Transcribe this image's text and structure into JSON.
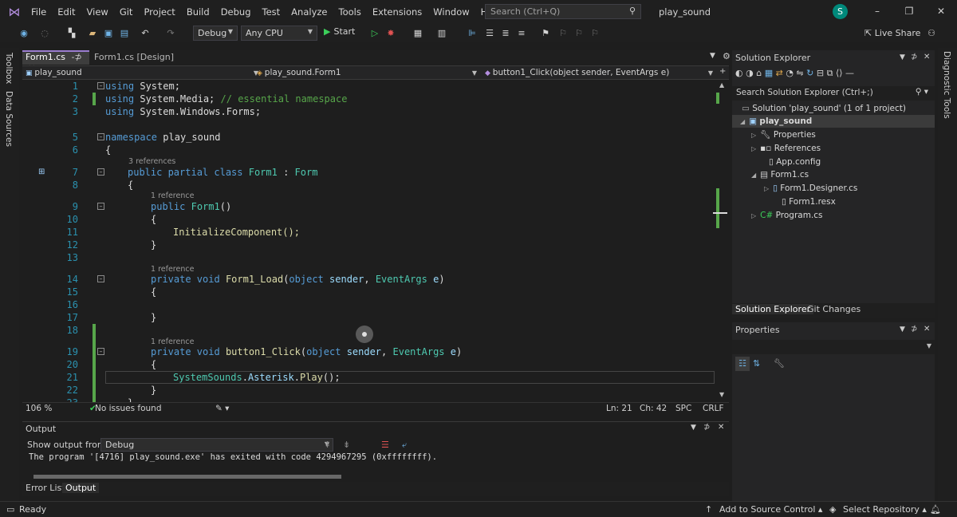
{
  "menu": {
    "items": [
      "File",
      "Edit",
      "View",
      "Git",
      "Project",
      "Build",
      "Debug",
      "Test",
      "Analyze",
      "Tools",
      "Extensions",
      "Window",
      "Help"
    ],
    "search_placeholder": "Search (Ctrl+Q)",
    "app_name": "play_sound",
    "avatar_letter": "S"
  },
  "toolbar": {
    "config": "Debug",
    "platform": "Any CPU",
    "start_label": "Start",
    "live_share": "Live Share"
  },
  "left_rail": {
    "toolbox": "Toolbox",
    "data_sources": "Data Sources"
  },
  "right_rail": {
    "diagnostic_tools": "Diagnostic Tools"
  },
  "tabs": {
    "active": "Form1.cs",
    "active_suffix": "-⊅",
    "designer": "Form1.cs [Design]"
  },
  "navbar": {
    "project": "play_sound",
    "class": "play_sound.Form1",
    "member": "button1_Click(object sender, EventArgs e)"
  },
  "editor": {
    "zoom": "106 %",
    "issues": "No issues found",
    "line": "Ln: 21",
    "col": "Ch: 42",
    "spc": "SPC",
    "eol": "CRLF",
    "refs": {
      "three": "3 references",
      "one": "1 reference"
    },
    "lines": {
      "l1": "using System;",
      "l2a": "using System.Media;",
      "l2b": "// essential namespace",
      "l3": "using System.Windows.Forms;",
      "l5a": "namespace",
      "l5b": "play_sound",
      "l6": "{",
      "l7a": "public partial class",
      "l7b": "Form1",
      "l7c": "Form",
      "l8": "{",
      "l9a": "public",
      "l9b": "Form1",
      "l10": "{",
      "l11": "InitializeComponent();",
      "l12": "}",
      "l14a": "private void",
      "l14b": "Form1_Load",
      "l14c": "object",
      "l14d": "sender",
      "l14e": "EventArgs",
      "l14f": "e",
      "l15": "{",
      "l17": "}",
      "l19a": "private void",
      "l19b": "button1_Click",
      "l19c": "object",
      "l19d": "sender",
      "l19e": "EventArgs",
      "l19f": "e",
      "l20": "{",
      "l21a": "SystemSounds",
      "l21b": "Asterisk",
      "l21c": "Play",
      "l22": "}",
      "l23": "}"
    }
  },
  "output": {
    "title": "Output",
    "show_from_label": "Show output from:",
    "source": "Debug",
    "text": "The program '[4716] play_sound.exe' has exited with code 4294967295 (0xffffffff)."
  },
  "bottom_tabs": {
    "error_list": "Error List",
    "output": "Output"
  },
  "solution_explorer": {
    "title": "Solution Explorer",
    "search_placeholder": "Search Solution Explorer (Ctrl+;)",
    "solution": "Solution 'play_sound' (1 of 1 project)",
    "project": "play_sound",
    "items": {
      "properties": "Properties",
      "references": "References",
      "app_config": "App.config",
      "form1": "Form1.cs",
      "form1_designer": "Form1.Designer.cs",
      "form1_resx": "Form1.resx",
      "program": "Program.cs"
    },
    "tab_se": "Solution Explorer",
    "tab_git": "Git Changes"
  },
  "properties": {
    "title": "Properties"
  },
  "status": {
    "ready": "Ready",
    "source_control": "Add to Source Control",
    "repository": "Select Repository"
  },
  "colors": {
    "keyword": "#569cd6",
    "type": "#4ec9b0",
    "function": "#dcdcaa",
    "comment": "#57a64a",
    "line_number": "#2b91af"
  }
}
